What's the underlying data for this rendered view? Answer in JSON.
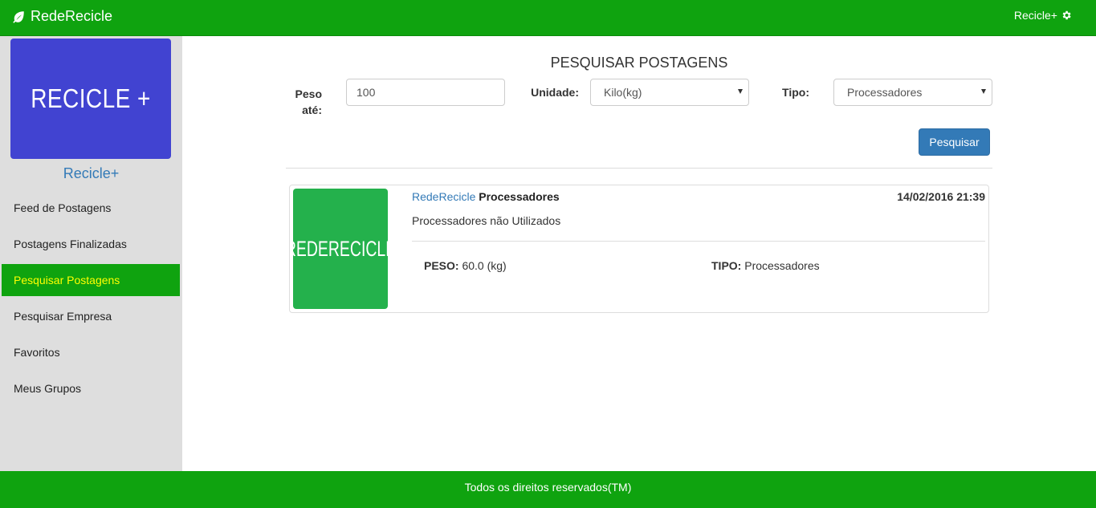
{
  "navbar": {
    "brand": "RedeRecicle",
    "brand_icon": "leaf-icon",
    "user_label": "Recicle+",
    "settings_icon": "gear-icon"
  },
  "sidebar": {
    "profile_image_text": "RECICLE +",
    "profile_name": "Recicle+",
    "items": [
      {
        "label": "Feed de Postagens"
      },
      {
        "label": "Postagens Finalizadas"
      },
      {
        "label": "Pesquisar Postagens",
        "active": true
      },
      {
        "label": "Pesquisar Empresa"
      },
      {
        "label": "Favoritos"
      },
      {
        "label": "Meus Grupos"
      }
    ]
  },
  "search": {
    "title": "PESQUISAR POSTAGENS",
    "peso_label_1": "Peso",
    "peso_label_2": "até:",
    "peso_value": "100",
    "unidade_label": "Unidade:",
    "unidade_value": "Kilo(kg)",
    "tipo_label": "Tipo:",
    "tipo_value": "Processadores",
    "button_label": "Pesquisar"
  },
  "results": [
    {
      "image_text": "REDERECICLE",
      "author": "RedeRecicle",
      "type": "Processadores",
      "date": "14/02/2016 21:39",
      "description": "Processadores não Utilizados",
      "peso_label": "PESO:",
      "peso_value": "60.0 (kg)",
      "tipo_label": "TIPO:",
      "tipo_value": "Processadores"
    }
  ],
  "footer": {
    "text": "Todos os direitos reservados(TM)"
  },
  "colors": {
    "brand_green": "#0fa30f",
    "sidebar_bg": "#dedede",
    "profile_blue": "#4143d1",
    "post_image_green": "#24b14c",
    "link_blue": "#337ab7",
    "active_text": "#ffff00"
  }
}
